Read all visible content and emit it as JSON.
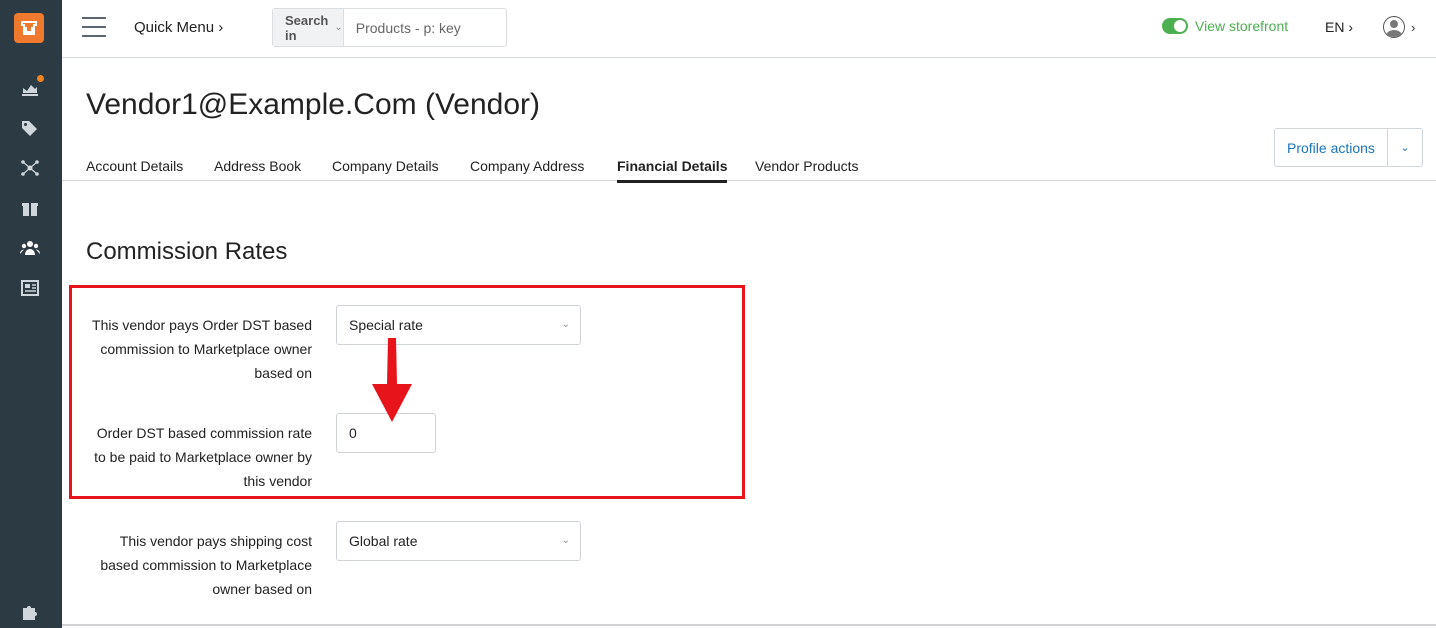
{
  "sidebar": {
    "items": [
      {
        "icon": "dashboard-icon"
      },
      {
        "icon": "tags-icon"
      },
      {
        "icon": "network-icon"
      },
      {
        "icon": "gift-icon"
      },
      {
        "icon": "users-icon"
      },
      {
        "icon": "newspaper-icon"
      },
      {
        "icon": "puzzle-icon"
      }
    ],
    "notification_color": "#f0851f"
  },
  "topbar": {
    "quick_menu": "Quick Menu ›",
    "search_in": "Search in",
    "search_placeholder": "Products - p: key",
    "view_storefront": "View storefront",
    "language": "EN ›",
    "user_chevron": "›"
  },
  "page": {
    "title": "Vendor1@Example.Com (Vendor)",
    "profile_actions": "Profile actions"
  },
  "tabs": [
    {
      "label": "Account Details",
      "active": false
    },
    {
      "label": "Address Book",
      "active": false
    },
    {
      "label": "Company Details",
      "active": false
    },
    {
      "label": "Company Address",
      "active": false
    },
    {
      "label": "Financial Details",
      "active": true
    },
    {
      "label": "Vendor Products",
      "active": false
    }
  ],
  "commission": {
    "section_title": "Commission Rates",
    "order_dst_basis": {
      "label": "This vendor pays Order DST based commission to Marketplace owner based on",
      "value": "Special rate"
    },
    "order_dst_rate": {
      "label": "Order DST based commission rate to be paid to Marketplace owner by this vendor",
      "value": "0"
    },
    "shipping_basis": {
      "label": "This vendor pays shipping cost based commission to Marketplace owner based on",
      "value": "Global rate"
    }
  },
  "colors": {
    "sidebar_bg": "#2c3a43",
    "logo_bg": "#ef7a2e",
    "accent_link": "#1a74b8",
    "storefront_green": "#4caf50",
    "annotation_red": "#e8141c"
  }
}
